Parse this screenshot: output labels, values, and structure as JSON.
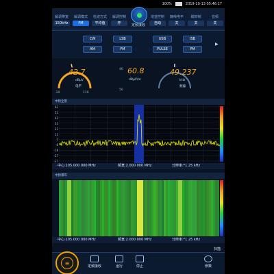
{
  "status": {
    "battery": "100%",
    "datetime": "2019-10-13 05:46:17"
  },
  "header": {
    "columns": [
      {
        "label": "解调带宽",
        "value": "150kHz"
      },
      {
        "label": "解调模式",
        "value": "FM",
        "active": true
      },
      {
        "label": "检波方式",
        "value": "平均值"
      },
      {
        "label": "解调控制",
        "value": "开"
      },
      {
        "label": "增益控制",
        "value": "自动"
      },
      {
        "label": "静噪电平",
        "value": "关"
      },
      {
        "label": "磁抑制",
        "value": "关"
      },
      {
        "label": "音频",
        "value": "关"
      }
    ],
    "center_label": "定频接收"
  },
  "modes": {
    "row1": [
      "CW",
      "LSB",
      "USB",
      "ISB"
    ],
    "row2": [
      "AM",
      "FM",
      "PULSE",
      "PM"
    ],
    "next_arrow": "▶"
  },
  "meters": {
    "level": {
      "value": "42.7",
      "unit": "dBμV",
      "label": "电平",
      "min": "-10",
      "max": "110",
      "fraction": 0.45
    },
    "field": {
      "value": "60.8",
      "unit": "dBμV/m",
      "low": "40",
      "high": "50"
    },
    "offset": {
      "value": "49.237",
      "unit": "kHz",
      "label": "频偏",
      "fraction": 0.5
    }
  },
  "spectrum": {
    "title": "中频全景",
    "y_ticks": [
      "62",
      "52",
      "42",
      "32",
      "22",
      "12",
      "2",
      "-8",
      "-18",
      "-27",
      "-37"
    ],
    "center": "中心:105.000 000 MHz",
    "span": "频宽:2.000 000 MHz",
    "resolution": "分辨率:*1.25 kHz",
    "colors": {
      "trace": "#e8e800",
      "band": "#1530a0"
    }
  },
  "waterfall": {
    "title": "中频瀑布",
    "center": "中心:105.000 000 MHz",
    "span": "频宽:2.000 000 MHz",
    "resolution": "分辨率:*1.25 kHz"
  },
  "bottom": {
    "items": [
      {
        "label": "定频接收"
      },
      {
        "label": "运行"
      },
      {
        "label": "停止"
      },
      {
        "label": "参数"
      }
    ],
    "scan_label": "扫描",
    "menu_glyph": "≡"
  }
}
